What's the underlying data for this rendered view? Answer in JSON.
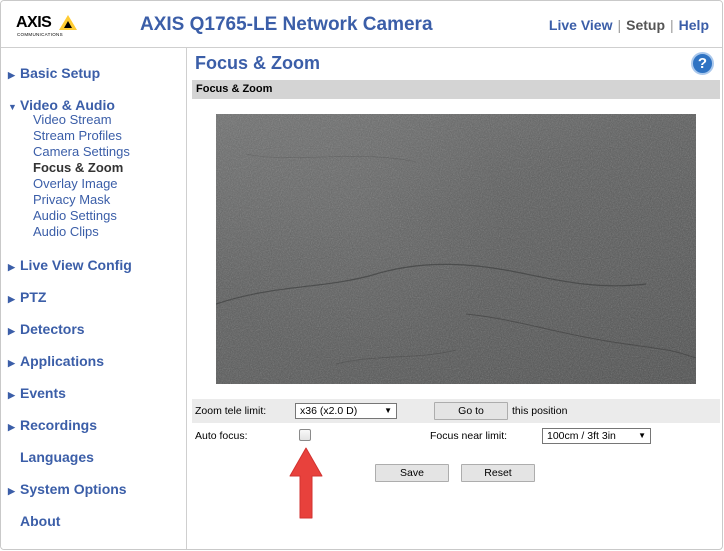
{
  "header": {
    "logo_text": "AXIS",
    "logo_sub": "COMMUNICATIONS",
    "title": "AXIS Q1765-LE Network Camera",
    "nav": [
      {
        "label": "Live View"
      },
      {
        "label": "Setup"
      },
      {
        "label": "Help"
      }
    ],
    "nav_sep": "|"
  },
  "sidebar": {
    "items": [
      {
        "label": "Basic Setup",
        "arrow": "▶"
      },
      {
        "label": "Video & Audio",
        "arrow": "▼"
      },
      {
        "label": "Live View Config",
        "arrow": "▶"
      },
      {
        "label": "PTZ",
        "arrow": "▶"
      },
      {
        "label": "Detectors",
        "arrow": "▶"
      },
      {
        "label": "Applications",
        "arrow": "▶"
      },
      {
        "label": "Events",
        "arrow": "▶"
      },
      {
        "label": "Recordings",
        "arrow": "▶"
      },
      {
        "label": "Languages",
        "arrow": ""
      },
      {
        "label": "System Options",
        "arrow": "▶"
      },
      {
        "label": "About",
        "arrow": ""
      }
    ],
    "video_audio_sub": [
      {
        "label": "Video Stream"
      },
      {
        "label": "Stream Profiles"
      },
      {
        "label": "Camera Settings"
      },
      {
        "label": "Focus & Zoom"
      },
      {
        "label": "Overlay Image"
      },
      {
        "label": "Privacy Mask"
      },
      {
        "label": "Audio Settings"
      },
      {
        "label": "Audio Clips"
      }
    ]
  },
  "main": {
    "page_title": "Focus & Zoom",
    "help_icon": "?",
    "section_title": "Focus & Zoom",
    "zoom_tele_limit_label": "Zoom tele limit:",
    "zoom_tele_limit_value": "x36 (x2.0 D)",
    "goto_button": "Go to",
    "goto_suffix": "this position",
    "auto_focus_label": "Auto focus:",
    "auto_focus_checked": false,
    "focus_near_limit_label": "Focus near limit:",
    "focus_near_limit_value": "100cm / 3ft 3in",
    "save_button": "Save",
    "reset_button": "Reset",
    "caret": "▼"
  },
  "colors": {
    "link_blue": "#3b5ea8",
    "section_bar": "#d4d4d4",
    "annotation_arrow": "#e8413c",
    "logo_yellow": "#ffcc33"
  },
  "icons": {
    "help": "question-circle-icon",
    "menu_collapsed": "triangle-right-icon",
    "menu_expanded": "triangle-down-icon",
    "dropdown": "caret-down-icon",
    "annotation": "red-up-arrow-icon"
  }
}
